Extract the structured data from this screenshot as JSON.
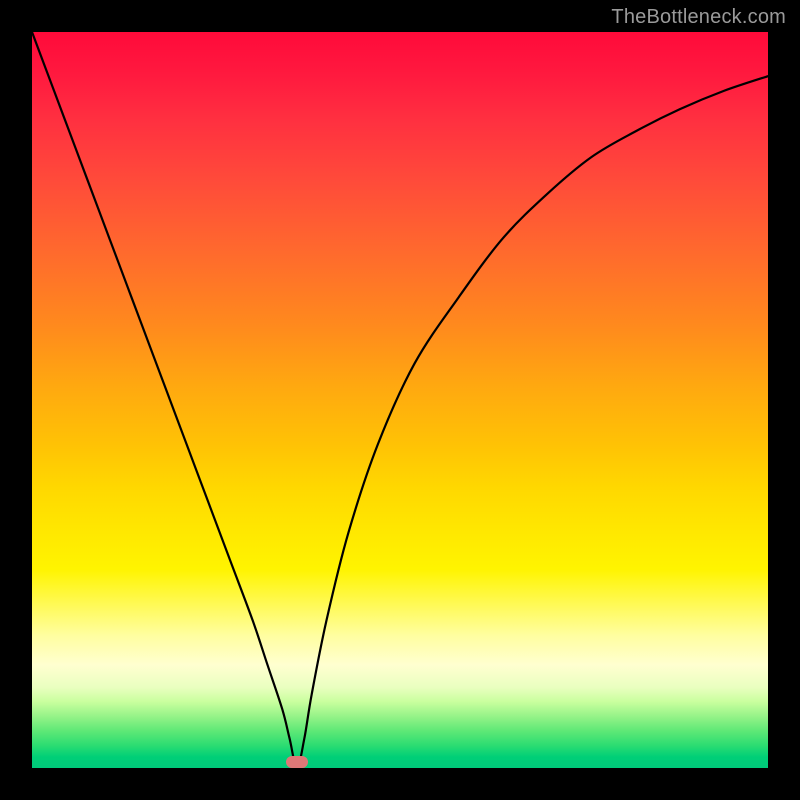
{
  "watermark": "TheBottleneck.com",
  "colors": {
    "frame_border": "#000000",
    "curve": "#000000",
    "dip_marker": "#dd7877",
    "watermark_text": "#9a9a9a"
  },
  "chart_data": {
    "type": "line",
    "title": "",
    "xlabel": "",
    "ylabel": "",
    "xlim": [
      0,
      100
    ],
    "ylim": [
      0,
      100
    ],
    "grid": false,
    "legend": false,
    "dip_x": 36,
    "dip_marker_width": 3,
    "series": [
      {
        "name": "bottleneck-curve",
        "x": [
          0,
          3,
          6,
          9,
          12,
          15,
          18,
          21,
          24,
          27,
          30,
          32,
          34,
          35,
          36,
          37,
          38,
          40,
          43,
          47,
          52,
          58,
          64,
          70,
          76,
          82,
          88,
          94,
          100
        ],
        "values": [
          100,
          92,
          84,
          76,
          68,
          60,
          52,
          44,
          36,
          28,
          20,
          14,
          8,
          4,
          0,
          4,
          10,
          20,
          32,
          44,
          55,
          64,
          72,
          78,
          83,
          86.5,
          89.5,
          92,
          94
        ]
      }
    ]
  }
}
